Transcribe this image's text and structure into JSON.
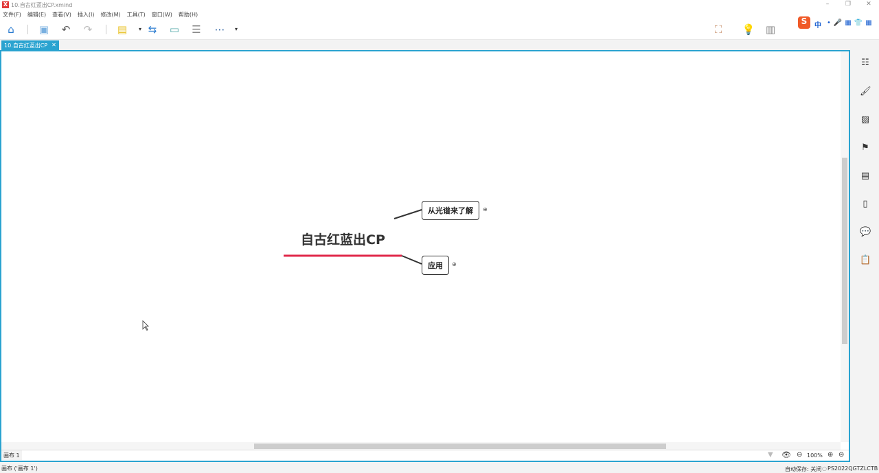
{
  "window": {
    "title": "10.自古红蓝出CP.xmind",
    "logo": "X"
  },
  "menu": [
    "文件(F)",
    "编辑(E)",
    "查看(V)",
    "插入(I)",
    "修改(M)",
    "工具(T)",
    "窗口(W)",
    "帮助(H)"
  ],
  "tab": {
    "label": "10.自古红蓝出CP",
    "close": "✕"
  },
  "map": {
    "central": "自古红蓝出CP",
    "topics": [
      "从光谱来了解",
      "应用"
    ],
    "accent": "#e0284a"
  },
  "sheet": {
    "name": "画布 1"
  },
  "zoom": {
    "value": "100%"
  },
  "status": {
    "left": "画布 ('画布 1')",
    "autosave": "自动保存: 关闭",
    "user": "PS2022QGTZLCTB"
  },
  "ime": {
    "label": "中"
  }
}
